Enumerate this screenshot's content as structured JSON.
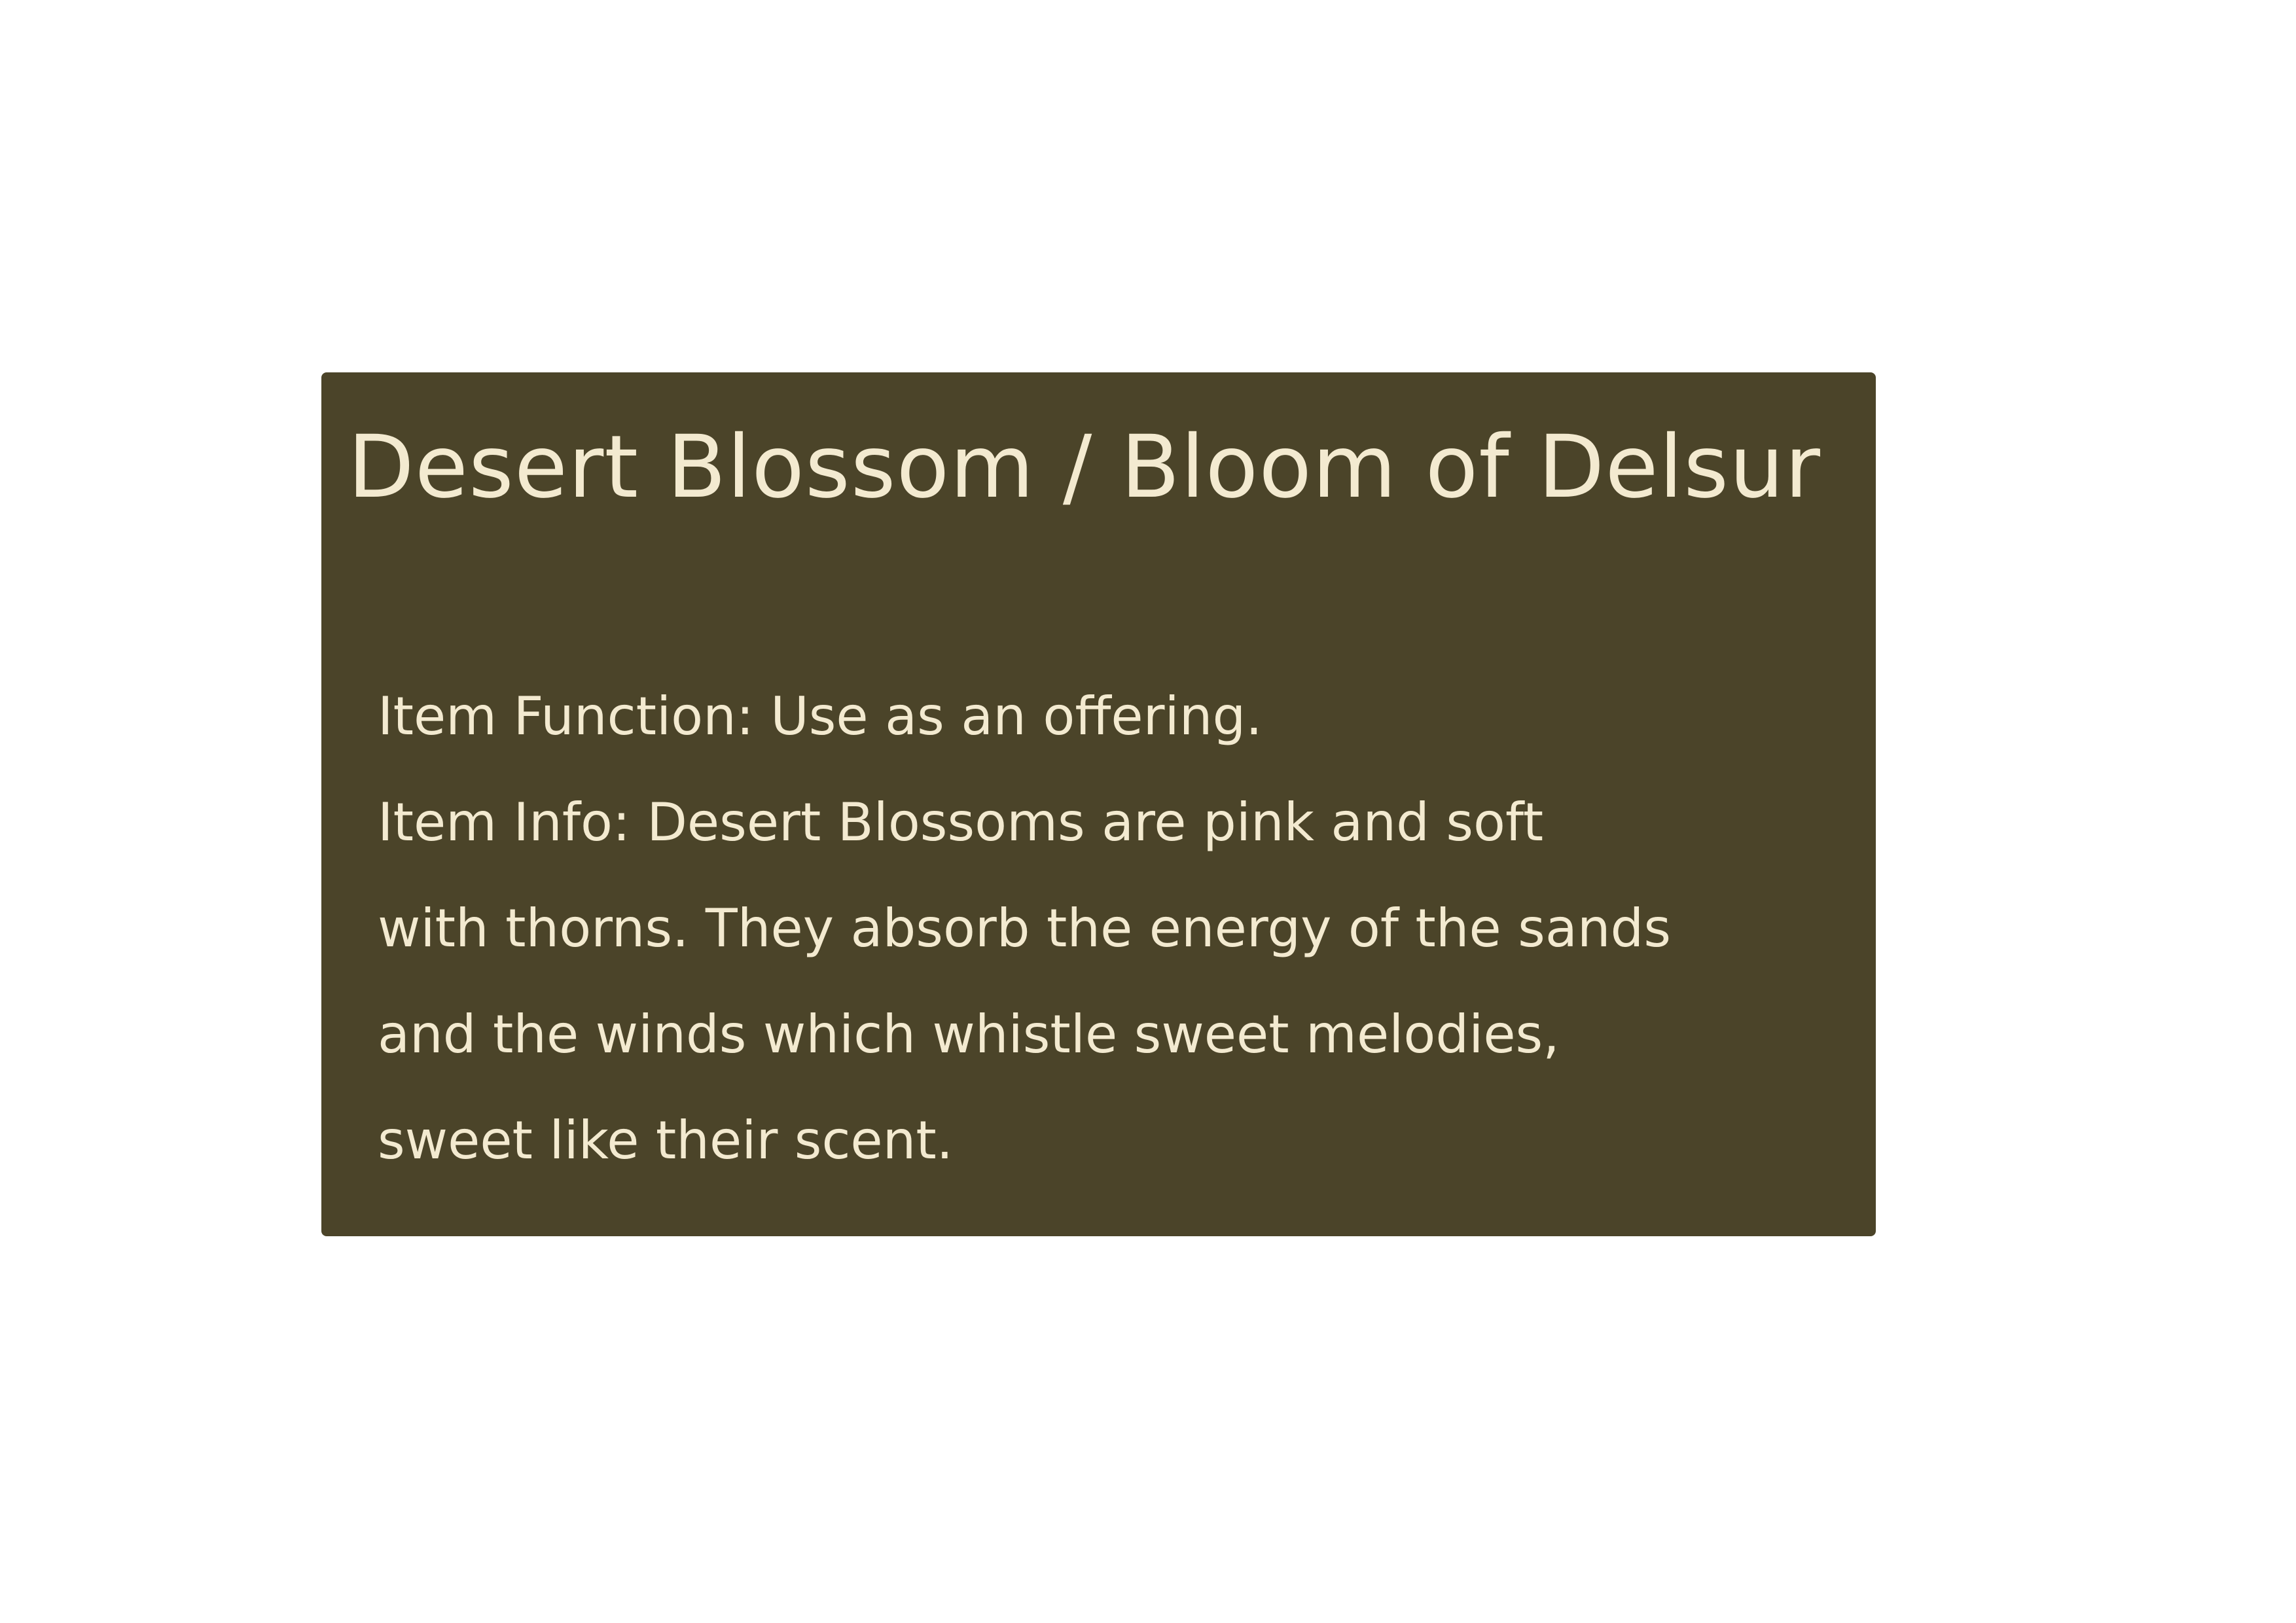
{
  "item": {
    "title": "Desert Blossom / Bloom of Delsur",
    "function_line": "Item Function: Use as an offering.",
    "info_lines": [
      "Item Info: Desert Blossoms are pink and soft",
      "with thorns. They absorb the energy of the sands",
      "and the winds which whistle sweet melodies,",
      "sweet like their scent."
    ]
  },
  "colors": {
    "card_background": "#4b4429",
    "text": "#f3ead0",
    "page_background": "#ffffff"
  }
}
